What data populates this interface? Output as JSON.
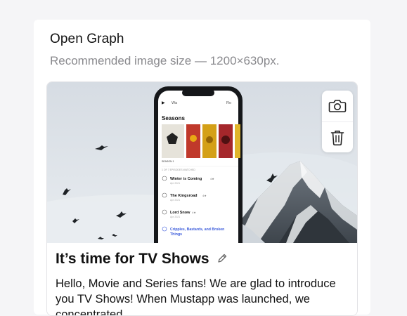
{
  "section": {
    "title": "Open Graph",
    "hint": "Recommended image size — 1200×630px."
  },
  "og": {
    "title": "It’s time for TV Shows",
    "description": "Hello, Movie and Series fans! We are glad to introduce you TV Shows! When Mustapp was launched, we concentrated"
  },
  "phone_screen": {
    "nav_label": "Wa",
    "nav_right": "Ro",
    "heading": "Seasons",
    "season_label": "SEASON 1",
    "list_header": "1 OF 7 EPISODES WATCHED",
    "episodes": [
      {
        "title": "Winter is Coming",
        "rating": "4★",
        "date": "Apr 2021"
      },
      {
        "title": "The Kingsroad",
        "rating": "4★",
        "date": "Apr 2021"
      },
      {
        "title": "Lord Snow",
        "rating": "4★",
        "date": "Apr 2021"
      },
      {
        "title": "Cripples, Bastards, and Broken Things",
        "rating": "",
        "date": ""
      }
    ]
  },
  "icons": {
    "camera": "camera-icon",
    "trash": "trash-icon",
    "edit": "pencil-icon"
  },
  "colors": {
    "page_bg": "#f5f5f7",
    "card_bg": "#ffffff",
    "hint_text": "#8a8a8e",
    "link_blue": "#3b5bdb"
  }
}
